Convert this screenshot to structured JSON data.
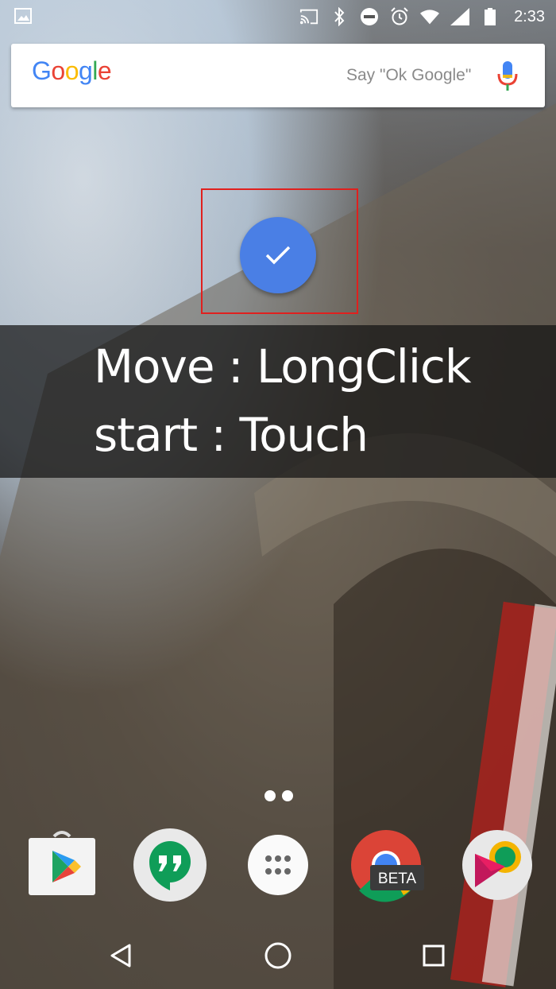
{
  "status_bar": {
    "time": "2:33",
    "icons": [
      "image-notification-icon",
      "cast-icon",
      "bluetooth-icon",
      "do-not-disturb-icon",
      "alarm-icon",
      "wifi-icon",
      "cell-signal-icon",
      "battery-icon"
    ]
  },
  "search": {
    "logo_letters": [
      {
        "ch": "G",
        "color": "#4285F4"
      },
      {
        "ch": "o",
        "color": "#EA4335"
      },
      {
        "ch": "o",
        "color": "#FBBC05"
      },
      {
        "ch": "g",
        "color": "#4285F4"
      },
      {
        "ch": "l",
        "color": "#34A853"
      },
      {
        "ch": "e",
        "color": "#EA4335"
      }
    ],
    "hint": "Say \"Ok Google\""
  },
  "fab": {
    "icon": "checkmark-icon",
    "color": "#4a7fe5"
  },
  "overlay": {
    "line1": "Move : LongClick",
    "line2": "start : Touch"
  },
  "pages": {
    "count": 2,
    "current": 1
  },
  "dock": {
    "apps": [
      {
        "name": "play-store",
        "icon": "play-store-icon"
      },
      {
        "name": "hangouts",
        "icon": "hangouts-icon"
      },
      {
        "name": "app-drawer",
        "icon": "app-drawer-icon"
      },
      {
        "name": "chrome-beta",
        "icon": "chrome-beta-icon",
        "badge": "BETA"
      },
      {
        "name": "play-movies",
        "icon": "play-movies-icon"
      }
    ]
  },
  "nav": {
    "buttons": [
      "back-icon",
      "home-icon",
      "recents-icon"
    ]
  },
  "colors": {
    "accent": "#4a7fe5",
    "selection": "#e0201e",
    "overlay": "rgba(20,20,20,0.72)"
  }
}
